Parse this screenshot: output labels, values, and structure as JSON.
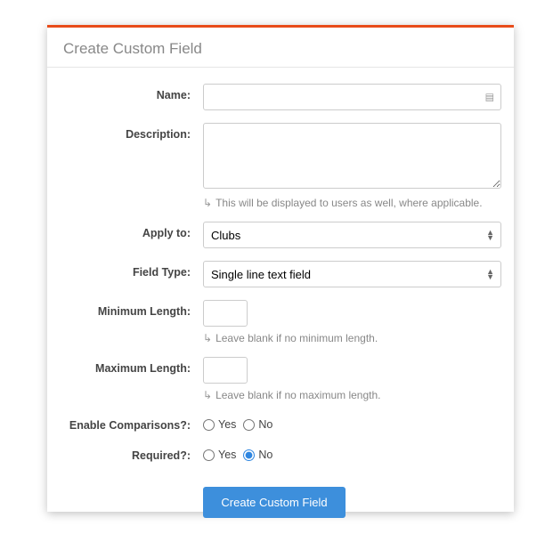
{
  "page": {
    "title": "Create Custom Field"
  },
  "form": {
    "name": {
      "label": "Name:",
      "value": ""
    },
    "description": {
      "label": "Description:",
      "value": "",
      "hint": "This will be displayed to users as well, where applicable."
    },
    "apply_to": {
      "label": "Apply to:",
      "value": "Clubs"
    },
    "field_type": {
      "label": "Field Type:",
      "value": "Single line text field"
    },
    "min_length": {
      "label": "Minimum Length:",
      "value": "",
      "hint": "Leave blank if no minimum length."
    },
    "max_length": {
      "label": "Maximum Length:",
      "value": "",
      "hint": "Leave blank if no maximum length."
    },
    "enable_comparisons": {
      "label": "Enable Comparisons?:",
      "yes": "Yes",
      "no": "No",
      "value": ""
    },
    "required": {
      "label": "Required?:",
      "yes": "Yes",
      "no": "No",
      "value": "No"
    },
    "submit": "Create Custom Field"
  }
}
